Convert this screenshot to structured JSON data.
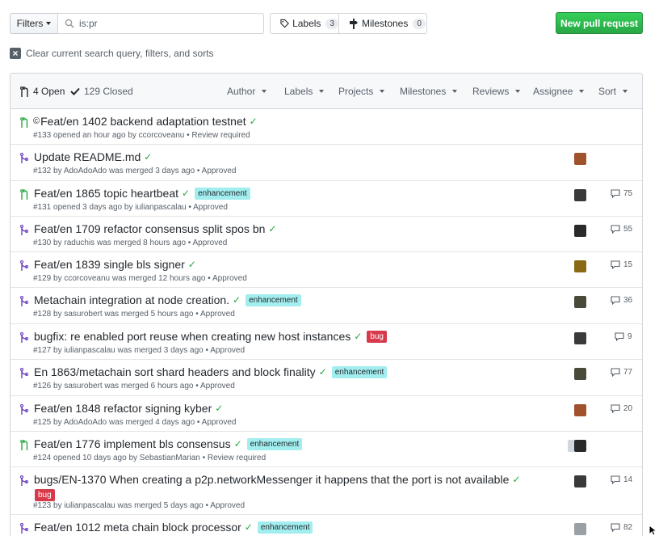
{
  "toolbar": {
    "filters_label": "Filters",
    "search_value": "is:pr",
    "labels_label": "Labels",
    "labels_count": "3",
    "milestones_label": "Milestones",
    "milestones_count": "0",
    "new_pr_label": "New pull request",
    "clear_query_label": "Clear current search query, filters, and sorts"
  },
  "header": {
    "open_label": "4 Open",
    "closed_label": "129 Closed",
    "filters": [
      "Author",
      "Labels",
      "Projects",
      "Milestones",
      "Reviews",
      "Assignee",
      "Sort"
    ]
  },
  "icons": {
    "filters_caret": "chevron-down-icon",
    "search": "search-icon",
    "labels": "tag-icon",
    "milestones": "milestone-icon",
    "clear": "x-square-icon",
    "open": "pull-request-icon",
    "closed": "check-icon",
    "comment": "comment-icon"
  },
  "colors": {
    "open_icon": "#28a745",
    "merged_icon": "#6f42c1",
    "enhancement_label": "#a2eeef",
    "bug_label": "#d73a4a",
    "new_pr_button": "#28a745",
    "check": "#28a745"
  },
  "pulls": [
    {
      "title": "Feat/en 1402 backend adaptation testnet",
      "prefix": "©",
      "state": "open",
      "meta": "#133 opened an hour ago by ccorcoveanu • Review required",
      "labels": [],
      "comments": "",
      "avatar": ""
    },
    {
      "title": "Update README.md",
      "prefix": "",
      "state": "merged",
      "meta": "#132 by AdoAdoAdo was merged 3 days ago • Approved",
      "labels": [],
      "comments": "",
      "avatar": "#a0522d"
    },
    {
      "title": "Feat/en 1865 topic heartbeat",
      "prefix": "",
      "state": "open",
      "meta": "#131 opened 3 days ago by iulianpascalau • Approved",
      "labels": [
        "enhancement"
      ],
      "comments": "75",
      "avatar": "#3a3a3a"
    },
    {
      "title": "Feat/en 1709 refactor consensus split spos bn",
      "prefix": "",
      "state": "merged",
      "meta": "#130 by raduchis was merged 8 hours ago • Approved",
      "labels": [],
      "comments": "55",
      "avatar": "#2a2a2a"
    },
    {
      "title": "Feat/en 1839 single bls signer",
      "prefix": "",
      "state": "merged",
      "meta": "#129 by ccorcoveanu was merged 12 hours ago • Approved",
      "labels": [],
      "comments": "15",
      "avatar": "#8b6914"
    },
    {
      "title": "Metachain integration at node creation.",
      "prefix": "",
      "state": "merged",
      "meta": "#128 by sasurobert was merged 5 hours ago • Approved",
      "labels": [
        "enhancement"
      ],
      "comments": "36",
      "avatar": "#4a4a3a"
    },
    {
      "title": "bugfix: re enabled port reuse when creating new host instances",
      "prefix": "",
      "state": "merged",
      "meta": "#127 by iulianpascalau was merged 3 days ago • Approved",
      "labels": [
        "bug"
      ],
      "comments": "9",
      "avatar": "#3a3a3a"
    },
    {
      "title": "En 1863/metachain sort shard headers and block finality",
      "prefix": "",
      "state": "merged",
      "meta": "#126 by sasurobert was merged 6 hours ago • Approved",
      "labels": [
        "enhancement"
      ],
      "comments": "77",
      "avatar": "#4a4a3a"
    },
    {
      "title": "Feat/en 1848 refactor signing kyber",
      "prefix": "",
      "state": "merged",
      "meta": "#125 by AdoAdoAdo was merged 4 days ago • Approved",
      "labels": [],
      "comments": "20",
      "avatar": "#a0522d"
    },
    {
      "title": "Feat/en 1776 implement bls consensus",
      "prefix": "",
      "state": "open",
      "meta": "#124 opened 10 days ago by SebastianMarian • Review required",
      "labels": [
        "enhancement"
      ],
      "comments": "",
      "avatar": "#2a2a2a"
    },
    {
      "title": "bugs/EN-1370 When creating a p2p.networkMessenger it happens that the port is not available",
      "prefix": "",
      "state": "merged",
      "meta": "#123 by iulianpascalau was merged 5 days ago • Approved",
      "labels": [
        "bug"
      ],
      "comments": "14",
      "avatar": "#3a3a3a"
    },
    {
      "title": "Feat/en 1012 meta chain block processor",
      "prefix": "",
      "state": "merged",
      "meta": "",
      "labels": [
        "enhancement"
      ],
      "comments": "82",
      "avatar": "#9aa0a6"
    }
  ]
}
